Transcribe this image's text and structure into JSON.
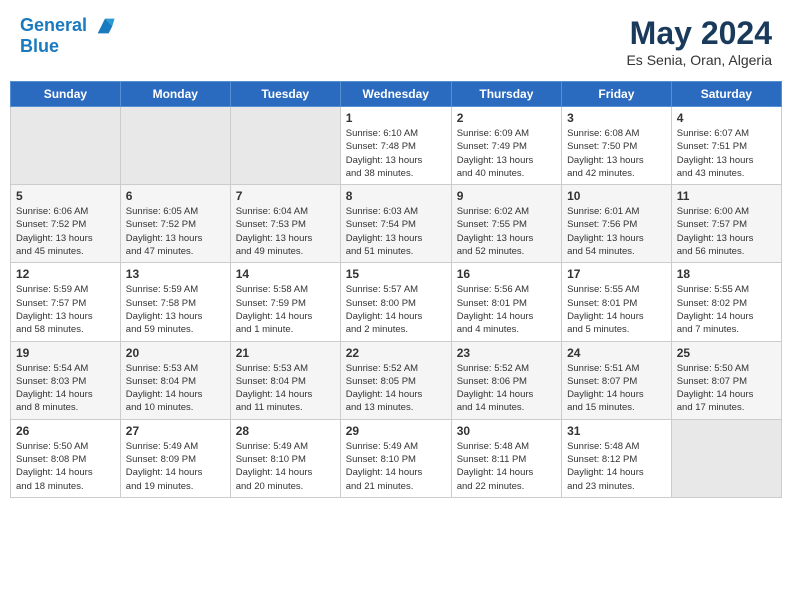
{
  "header": {
    "logo_line1": "General",
    "logo_line2": "Blue",
    "month": "May 2024",
    "location": "Es Senia, Oran, Algeria"
  },
  "days_of_week": [
    "Sunday",
    "Monday",
    "Tuesday",
    "Wednesday",
    "Thursday",
    "Friday",
    "Saturday"
  ],
  "weeks": [
    [
      {
        "day": "",
        "info": ""
      },
      {
        "day": "",
        "info": ""
      },
      {
        "day": "",
        "info": ""
      },
      {
        "day": "1",
        "info": "Sunrise: 6:10 AM\nSunset: 7:48 PM\nDaylight: 13 hours\nand 38 minutes."
      },
      {
        "day": "2",
        "info": "Sunrise: 6:09 AM\nSunset: 7:49 PM\nDaylight: 13 hours\nand 40 minutes."
      },
      {
        "day": "3",
        "info": "Sunrise: 6:08 AM\nSunset: 7:50 PM\nDaylight: 13 hours\nand 42 minutes."
      },
      {
        "day": "4",
        "info": "Sunrise: 6:07 AM\nSunset: 7:51 PM\nDaylight: 13 hours\nand 43 minutes."
      }
    ],
    [
      {
        "day": "5",
        "info": "Sunrise: 6:06 AM\nSunset: 7:52 PM\nDaylight: 13 hours\nand 45 minutes."
      },
      {
        "day": "6",
        "info": "Sunrise: 6:05 AM\nSunset: 7:52 PM\nDaylight: 13 hours\nand 47 minutes."
      },
      {
        "day": "7",
        "info": "Sunrise: 6:04 AM\nSunset: 7:53 PM\nDaylight: 13 hours\nand 49 minutes."
      },
      {
        "day": "8",
        "info": "Sunrise: 6:03 AM\nSunset: 7:54 PM\nDaylight: 13 hours\nand 51 minutes."
      },
      {
        "day": "9",
        "info": "Sunrise: 6:02 AM\nSunset: 7:55 PM\nDaylight: 13 hours\nand 52 minutes."
      },
      {
        "day": "10",
        "info": "Sunrise: 6:01 AM\nSunset: 7:56 PM\nDaylight: 13 hours\nand 54 minutes."
      },
      {
        "day": "11",
        "info": "Sunrise: 6:00 AM\nSunset: 7:57 PM\nDaylight: 13 hours\nand 56 minutes."
      }
    ],
    [
      {
        "day": "12",
        "info": "Sunrise: 5:59 AM\nSunset: 7:57 PM\nDaylight: 13 hours\nand 58 minutes."
      },
      {
        "day": "13",
        "info": "Sunrise: 5:59 AM\nSunset: 7:58 PM\nDaylight: 13 hours\nand 59 minutes."
      },
      {
        "day": "14",
        "info": "Sunrise: 5:58 AM\nSunset: 7:59 PM\nDaylight: 14 hours\nand 1 minute."
      },
      {
        "day": "15",
        "info": "Sunrise: 5:57 AM\nSunset: 8:00 PM\nDaylight: 14 hours\nand 2 minutes."
      },
      {
        "day": "16",
        "info": "Sunrise: 5:56 AM\nSunset: 8:01 PM\nDaylight: 14 hours\nand 4 minutes."
      },
      {
        "day": "17",
        "info": "Sunrise: 5:55 AM\nSunset: 8:01 PM\nDaylight: 14 hours\nand 5 minutes."
      },
      {
        "day": "18",
        "info": "Sunrise: 5:55 AM\nSunset: 8:02 PM\nDaylight: 14 hours\nand 7 minutes."
      }
    ],
    [
      {
        "day": "19",
        "info": "Sunrise: 5:54 AM\nSunset: 8:03 PM\nDaylight: 14 hours\nand 8 minutes."
      },
      {
        "day": "20",
        "info": "Sunrise: 5:53 AM\nSunset: 8:04 PM\nDaylight: 14 hours\nand 10 minutes."
      },
      {
        "day": "21",
        "info": "Sunrise: 5:53 AM\nSunset: 8:04 PM\nDaylight: 14 hours\nand 11 minutes."
      },
      {
        "day": "22",
        "info": "Sunrise: 5:52 AM\nSunset: 8:05 PM\nDaylight: 14 hours\nand 13 minutes."
      },
      {
        "day": "23",
        "info": "Sunrise: 5:52 AM\nSunset: 8:06 PM\nDaylight: 14 hours\nand 14 minutes."
      },
      {
        "day": "24",
        "info": "Sunrise: 5:51 AM\nSunset: 8:07 PM\nDaylight: 14 hours\nand 15 minutes."
      },
      {
        "day": "25",
        "info": "Sunrise: 5:50 AM\nSunset: 8:07 PM\nDaylight: 14 hours\nand 17 minutes."
      }
    ],
    [
      {
        "day": "26",
        "info": "Sunrise: 5:50 AM\nSunset: 8:08 PM\nDaylight: 14 hours\nand 18 minutes."
      },
      {
        "day": "27",
        "info": "Sunrise: 5:49 AM\nSunset: 8:09 PM\nDaylight: 14 hours\nand 19 minutes."
      },
      {
        "day": "28",
        "info": "Sunrise: 5:49 AM\nSunset: 8:10 PM\nDaylight: 14 hours\nand 20 minutes."
      },
      {
        "day": "29",
        "info": "Sunrise: 5:49 AM\nSunset: 8:10 PM\nDaylight: 14 hours\nand 21 minutes."
      },
      {
        "day": "30",
        "info": "Sunrise: 5:48 AM\nSunset: 8:11 PM\nDaylight: 14 hours\nand 22 minutes."
      },
      {
        "day": "31",
        "info": "Sunrise: 5:48 AM\nSunset: 8:12 PM\nDaylight: 14 hours\nand 23 minutes."
      },
      {
        "day": "",
        "info": ""
      }
    ]
  ]
}
